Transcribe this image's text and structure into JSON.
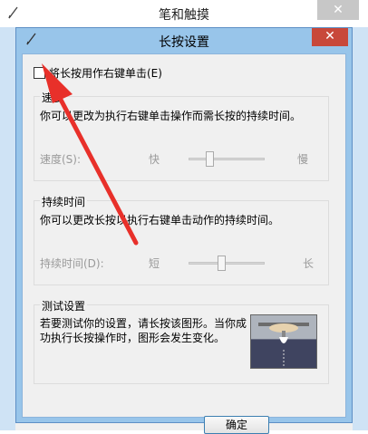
{
  "outer_window": {
    "title": "笔和触摸",
    "close_symbol": "✕"
  },
  "dialog": {
    "title": "长按设置",
    "close_symbol": "✕",
    "enable_checkbox": {
      "label": "将长按用作右键单击(E)",
      "checked": false
    },
    "speed_group": {
      "title": "速度",
      "description": "你可以更改为执行右键单击操作而需长按的持续时间。",
      "slider_label": "速度(S):",
      "low_label": "快",
      "high_label": "慢",
      "level": 0.25
    },
    "duration_group": {
      "title": "持续时间",
      "description": "你可以更改长按以执行右键单击动作的持续时间。",
      "slider_label": "持续时间(D):",
      "low_label": "短",
      "high_label": "长",
      "level": 0.42
    },
    "test_group": {
      "title": "测试设置",
      "description_line1": "若要测试你的设置，请长按该图形。当你成",
      "description_line2": "功执行长按操作时，图形会发生变化。"
    },
    "ok_button": "确定"
  },
  "colors": {
    "arrow": "#e8302a",
    "dialog_frame": "#98c5ea",
    "close_button": "#c8483a"
  }
}
